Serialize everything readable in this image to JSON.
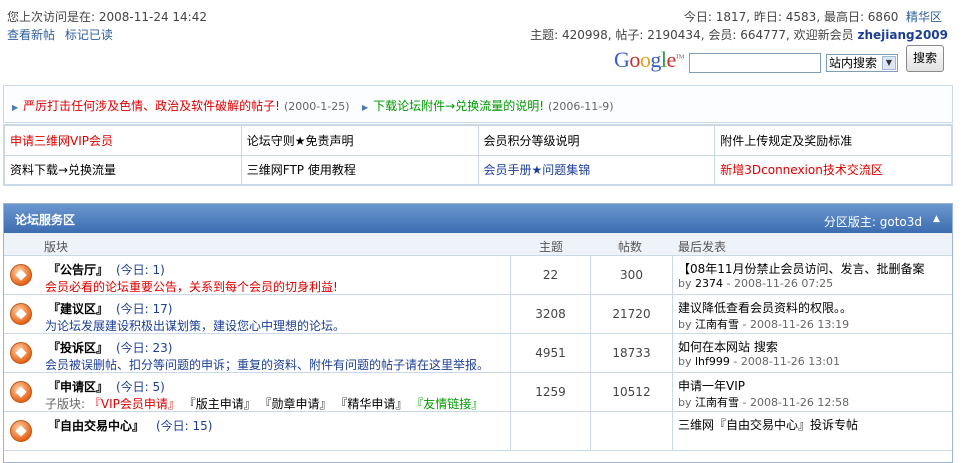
{
  "header": {
    "last_visit": "您上次访问是在: 2008-11-24 14:42",
    "links": [
      "查看新帖",
      "标记已读"
    ],
    "stats_line": "今日: 1817, 昨日: 4583, 最高日: 6860",
    "stats_link": "精华区",
    "totals_line": "主题: 420998, 帖子: 2190434, 会员: 664777, 欢迎新会员",
    "new_member": "zhejiang2009"
  },
  "search": {
    "logo": "Google",
    "scope_selected": "站内搜索",
    "button": "搜索"
  },
  "announcements": [
    {
      "text": "严厉打击任何涉及色情、政治及软件破解的帖子!",
      "date": "(2000-1-25)",
      "color": "#dd0000"
    },
    {
      "text": "下载论坛附件→兑换流量的说明!",
      "date": "(2006-11-9)",
      "color": "#009900"
    }
  ],
  "quick_links": [
    [
      "申请三维网VIP会员",
      "论坛守则★免责声明",
      "会员积分等级说明",
      "附件上传规定及奖励标准"
    ],
    [
      "资料下载→兑换流量",
      "三维网FTP 使用教程",
      "会员手册★问题集锦",
      "新增3Dconnexion技术交流区"
    ]
  ],
  "quick_link_colors": [
    [
      "#dd0000",
      "#000000",
      "#000000",
      "#000000"
    ],
    [
      "#000000",
      "#000000",
      "#1c3f94",
      "#dd0000"
    ]
  ],
  "forum_section": {
    "title": "论坛服务区",
    "moderator": "分区版主: goto3d",
    "columns": [
      "版块",
      "主题",
      "帖数",
      "最后发表"
    ],
    "rows": [
      {
        "name": "『公告厅』",
        "today": "(今日: 1)",
        "desc": "会员必看的论坛重要公告，关系到每个会员的切身利益!",
        "topics": "22",
        "posts": "300",
        "last_title": "【08年11月份禁止会员访问、发言、批删备案",
        "last_by": "by",
        "last_user": "2374",
        "last_time": "- 2008-11-26 07:25"
      },
      {
        "name": "『建议区』",
        "today": "(今日: 17)",
        "desc": "为论坛发展建设积极出谋划策，建设您心中理想的论坛。",
        "topics": "3208",
        "posts": "21720",
        "last_title": "建议降低查看会员资料的权限。。",
        "last_by": "by",
        "last_user": "江南有雪",
        "last_time": "- 2008-11-26 13:19"
      },
      {
        "name": "『投诉区』",
        "today": "(今日: 23)",
        "desc": "会员被误删帖、扣分等问题的申诉；重复的资料、附件有问题的帖子请在这里举报。",
        "topics": "4951",
        "posts": "18733",
        "last_title": "如何在本网站  搜索",
        "last_by": "by",
        "last_user": "lhf999",
        "last_time": "- 2008-11-26 13:01"
      },
      {
        "name": "『申请区』",
        "today": "(今日: 5)",
        "sub_label": "子版块:",
        "subforums": [
          "『VIP会员申请』",
          "『版主申请』",
          "『勋章申请』",
          "『精华申请』",
          "『友情链接』"
        ],
        "topics": "1259",
        "posts": "10512",
        "last_title": "申请一年VIP",
        "last_by": "by",
        "last_user": "江南有雪",
        "last_time": "- 2008-11-26 12:58"
      },
      {
        "name": "『自由交易中心』",
        "today": "(今日: 15)",
        "desc": "",
        "topics": "",
        "posts": "",
        "last_title": "三维网『自由交易中心』投诉专帖",
        "last_by": "",
        "last_user": "",
        "last_time": ""
      }
    ]
  }
}
